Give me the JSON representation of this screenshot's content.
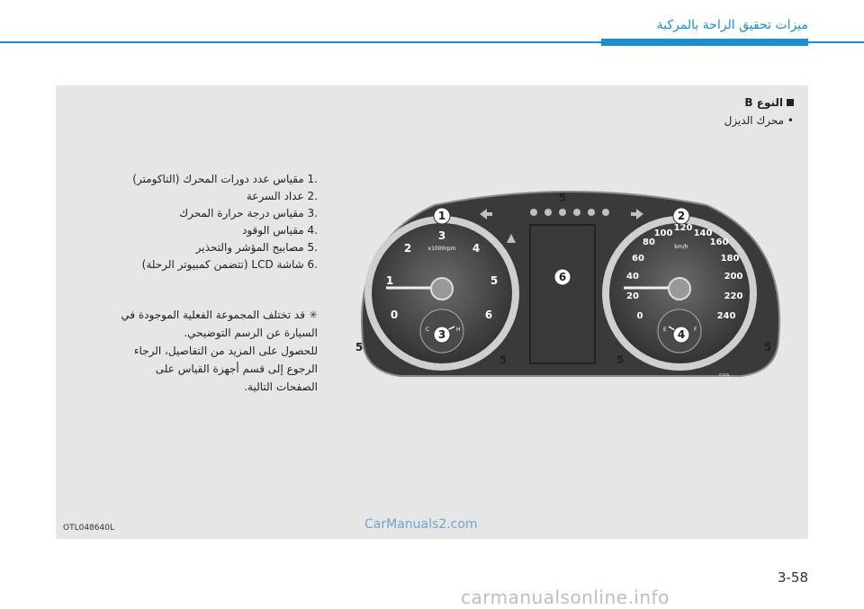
{
  "header": {
    "title": "ميزات تحقيق الراحة بالمركبة"
  },
  "section": {
    "title": "النوع B",
    "subtitle": "• محرك الديزل"
  },
  "items": [
    ".1  مقياس عدد دورات المحرك (التاكومتر)",
    ".2  عداد السرعة",
    ".3  مقياس درجة حرارة المحرك",
    ".4  مقياس الوقود",
    ".5  مصابيح المؤشر والتحذير",
    ".6  شاشة LCD (تتضمن كمبيوتر الرحلة)"
  ],
  "note": {
    "lines": [
      "قد تختلف المجموعة الفعلية الموجودة في",
      "السيارة عن الرسم التوضيحي.",
      "للحصول على المزيد من التفاصيل، الرجاء",
      "الرجوع إلى قسم أجهزة القياس على",
      "الصفحات التالية."
    ]
  },
  "figure": {
    "code": "OTL048640L",
    "tach_numbers": [
      "0",
      "1",
      "2",
      "3",
      "4",
      "5",
      "6"
    ],
    "tach_unit": "x1000rpm",
    "speed_numbers": [
      "0",
      "20",
      "40",
      "60",
      "80",
      "100",
      "120",
      "140",
      "160",
      "180",
      "200",
      "220",
      "240"
    ],
    "speed_unit": "km/h",
    "temp_labels": [
      "C",
      "H"
    ],
    "fuel_labels": [
      "E",
      "F"
    ],
    "callouts": [
      "1",
      "2",
      "3",
      "4",
      "5",
      "6"
    ],
    "epb_label": "EPB"
  },
  "watermark": "CarManuals2.com",
  "page_number": "3-58",
  "footer_watermark": "carmanualsonline.info"
}
